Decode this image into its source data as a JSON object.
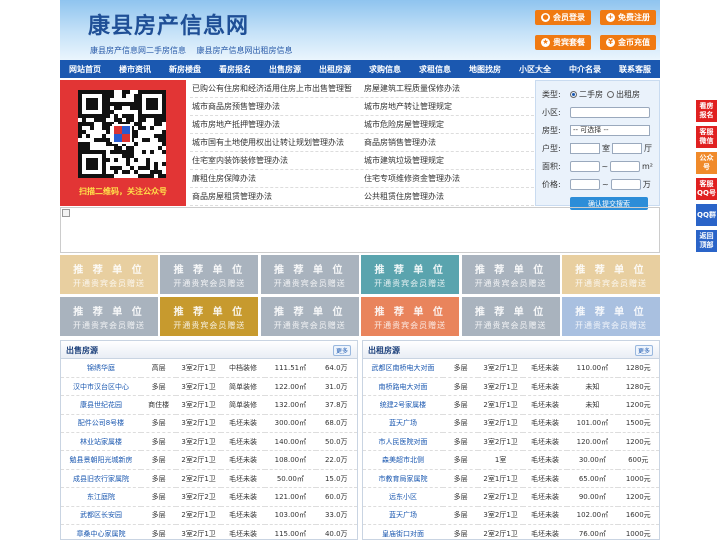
{
  "header": {
    "logo": "康县房产信息网",
    "subtitles": [
      "康县房产信息网二手房信息",
      "康县房产信息网出租房信息"
    ],
    "buttons": [
      {
        "label": "会员登录",
        "icon": "user-icon",
        "glyph": "●"
      },
      {
        "label": "免费注册",
        "icon": "register-icon",
        "glyph": "+"
      },
      {
        "label": "贵宾套餐",
        "icon": "vip-icon",
        "glyph": "★"
      },
      {
        "label": "金币充值",
        "icon": "coin-icon",
        "glyph": "¥"
      }
    ]
  },
  "nav": [
    "网站首页",
    "楼市资讯",
    "新房楼盘",
    "看房报名",
    "出售房源",
    "出租房源",
    "求购信息",
    "求租信息",
    "地图找房",
    "小区大全",
    "中介名录",
    "联系客服"
  ],
  "qr": {
    "caption": "扫描二维码，关注公众号"
  },
  "links": [
    [
      "已购公有住房和经济适用住房上市出售管理暂",
      "房屋建筑工程质量保修办法"
    ],
    [
      "城市商品房预售管理办法",
      "城市房地产转让管理规定"
    ],
    [
      "城市房地产抵押管理办法",
      "城市危险房屋管理规定"
    ],
    [
      "城市国有土地使用权出让转让规划管理办法",
      "商品房销售管理办法"
    ],
    [
      "住宅室内装饰装修管理办法",
      "城市建筑垃圾管理规定"
    ],
    [
      "廉租住房保障办法",
      "住宅专项维修资金管理办法"
    ],
    [
      "商品房屋租赁管理办法",
      "公共租赁住房管理办法"
    ]
  ],
  "search": {
    "type_label": "类型:",
    "type_options": [
      "二手房",
      "出租房"
    ],
    "community_label": "小区:",
    "house_type_label": "房型:",
    "house_type_value": "-- 可选择 --",
    "layout_label": "户型:",
    "room_unit": "室",
    "hall_unit": "厅",
    "area_label": "面积:",
    "area_unit": "m²",
    "range_sep": "~",
    "price_label": "价格:",
    "price_unit": "万",
    "submit": "确认提交搜索"
  },
  "promo": {
    "title": "推 荐 单 位",
    "sub": "开通贵宾会员赠送",
    "colors": [
      [
        "#e8cfa0",
        "#a9b3be",
        "#a9b3be",
        "#5aa4ae",
        "#a9b3be",
        "#e8cfa0"
      ],
      [
        "#a9b3be",
        "#c79a2e",
        "#a9b3be",
        "#e9845c",
        "#a9b3be",
        "#a9c0e0"
      ]
    ]
  },
  "sale": {
    "title": "出售房源",
    "more": "更多",
    "rows": [
      [
        "锦绣华庭",
        "高层",
        "3室2厅1卫",
        "中档装修",
        "111.51㎡",
        "64.0万"
      ],
      [
        "汉中市汉台区中心",
        "多层",
        "3室2厅1卫",
        "简单装修",
        "122.00㎡",
        "31.0万"
      ],
      [
        "康县世纪花园",
        "商住楼",
        "3室2厅1卫",
        "简单装修",
        "132.00㎡",
        "37.8万"
      ],
      [
        "配件公司8号楼",
        "多层",
        "3室2厅1卫",
        "毛坯未装",
        "300.00㎡",
        "68.0万"
      ],
      [
        "林业站家属楼",
        "多层",
        "3室2厅1卫",
        "毛坯未装",
        "140.00㎡",
        "50.0万"
      ],
      [
        "勉县景朝阳光城新房",
        "多层",
        "2室2厅1卫",
        "毛坯未装",
        "108.00㎡",
        "22.0万"
      ],
      [
        "成县旧农行家属院",
        "多层",
        "2室2厅1卫",
        "毛坯未装",
        "50.00㎡",
        "15.0万"
      ],
      [
        "东江庭院",
        "多层",
        "3室2厅2卫",
        "毛坯未装",
        "121.00㎡",
        "60.0万"
      ],
      [
        "武都区长安园",
        "多层",
        "2室2厅1卫",
        "毛坯未装",
        "103.00㎡",
        "33.0万"
      ],
      [
        "章桑中心家属院",
        "多层",
        "3室2厅1卫",
        "毛坯未装",
        "115.00㎡",
        "40.0万"
      ]
    ]
  },
  "rent": {
    "title": "出租房源",
    "more": "更多",
    "rows": [
      [
        "武都区南桥电大对面",
        "多层",
        "3室2厅1卫",
        "毛坯未装",
        "110.00㎡",
        "1280元"
      ],
      [
        "南桥路电大对面",
        "多层",
        "3室2厅1卫",
        "毛坯未装",
        "未知",
        "1280元"
      ],
      [
        "统建2号家属楼",
        "多层",
        "2室1厅1卫",
        "毛坯未装",
        "未知",
        "1200元"
      ],
      [
        "蓝天广场",
        "多层",
        "3室2厅1卫",
        "毛坯未装",
        "101.00㎡",
        "1500元"
      ],
      [
        "市人民医院对面",
        "多层",
        "3室2厅1卫",
        "毛坯未装",
        "120.00㎡",
        "1200元"
      ],
      [
        "森美超市北侧",
        "多层",
        "1室",
        "毛坯未装",
        "30.00㎡",
        "600元"
      ],
      [
        "市教育局家属院",
        "多层",
        "2室1厅1卫",
        "毛坯未装",
        "65.00㎡",
        "1000元"
      ],
      [
        "远东小区",
        "多层",
        "2室2厅1卫",
        "毛坯未装",
        "90.00㎡",
        "1200元"
      ],
      [
        "蓝天广场",
        "多层",
        "3室2厅1卫",
        "毛坯未装",
        "102.00㎡",
        "1600元"
      ],
      [
        "皇庙街口对面",
        "多层",
        "2室2厅1卫",
        "毛坯未装",
        "76.00㎡",
        "1000元"
      ]
    ]
  },
  "side": [
    {
      "label": "看房报名",
      "color": "#e02020"
    },
    {
      "label": "客服微信",
      "color": "#e02020"
    },
    {
      "label": "公众号",
      "color": "#f08a2a"
    },
    {
      "label": "客服QQ号",
      "color": "#e02020"
    },
    {
      "label": "QQ群",
      "color": "#2a64c8"
    },
    {
      "label": "返回顶部",
      "color": "#2a64c8"
    }
  ]
}
